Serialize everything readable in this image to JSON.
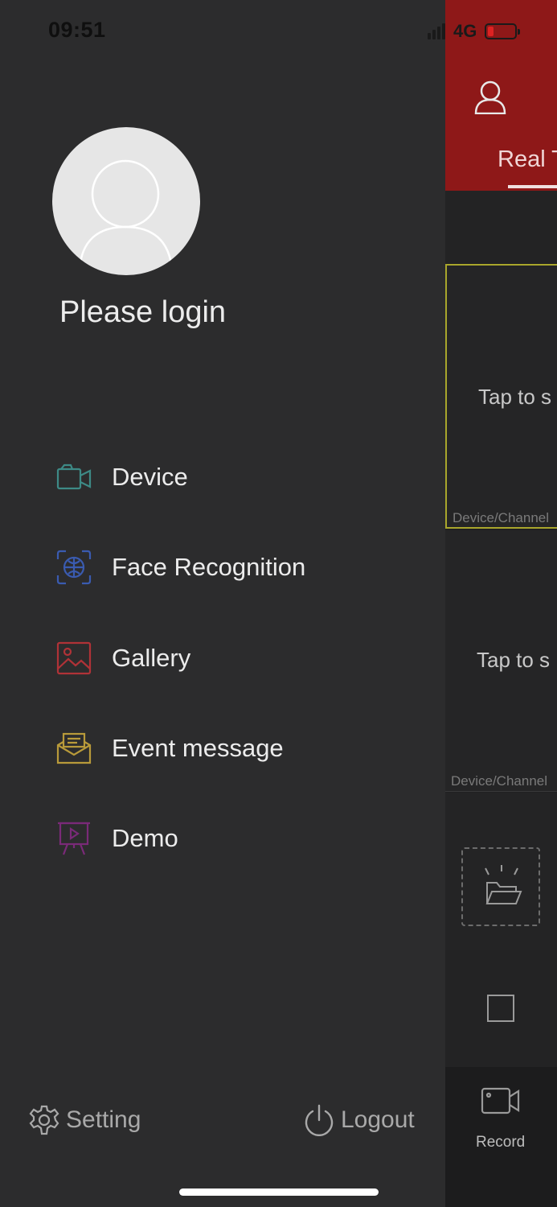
{
  "status_bar": {
    "time": "09:51",
    "network": "4G",
    "battery_color": "#dd2222"
  },
  "drawer": {
    "avatar_icon": "user-avatar-placeholder",
    "login_text": "Please login",
    "menu": [
      {
        "label": "Device",
        "icon": "camera-icon",
        "color": "#3d8a86"
      },
      {
        "label": "Face Recognition",
        "icon": "face-recognition-icon",
        "color": "#3a5bb0"
      },
      {
        "label": "Gallery",
        "icon": "gallery-icon",
        "color": "#b03237"
      },
      {
        "label": "Event message",
        "icon": "event-message-icon",
        "color": "#b89a3a"
      },
      {
        "label": "Demo",
        "icon": "demo-presentation-icon",
        "color": "#7a2a78"
      }
    ],
    "setting_label": "Setting",
    "logout_label": "Logout"
  },
  "background_app": {
    "header_color": "#8e1818",
    "tab_label": "Real T",
    "channels": [
      {
        "tap_text": "Tap to s",
        "label": "Device/Channel"
      },
      {
        "tap_text": "Tap to s",
        "label": "Device/Channel"
      }
    ],
    "record_label": "Record"
  }
}
